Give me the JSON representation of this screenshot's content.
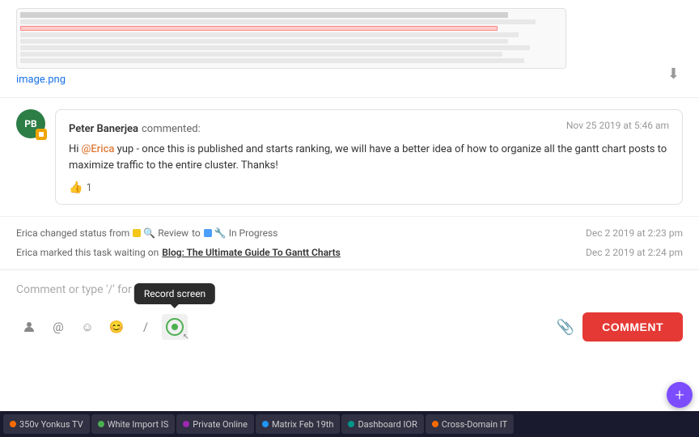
{
  "image": {
    "filename": "image.png",
    "download_label": "⬇",
    "alt": "spreadsheet screenshot"
  },
  "comment": {
    "author": "Peter Banerjea",
    "action": "commented:",
    "timestamp": "Nov 25 2019 at 5:46 am",
    "avatar_initials": "PB",
    "text_part1": "Hi ",
    "mention": "@Erica",
    "text_part2": " yup - once this is published and starts ranking, we will have a better idea of how to organize all the gantt chart posts to maximize traffic to the entire cluster. Thanks!",
    "likes": "1"
  },
  "activities": [
    {
      "text_prefix": "Erica changed status from",
      "from_status": "Review",
      "from_color": "#f5c518",
      "to_label": "to",
      "to_status": "In Progress",
      "to_color": "#4a9eff",
      "timestamp": "Dec 2 2019 at 2:23 pm"
    },
    {
      "text_prefix": "Erica marked this task waiting on",
      "link": "Blog: The Ultimate Guide To Gantt Charts",
      "timestamp": "Dec 2 2019 at 2:24 pm"
    }
  ],
  "comment_input": {
    "placeholder": "Comment or type '/' for commands"
  },
  "tooltip": {
    "label": "Record screen"
  },
  "toolbar": {
    "icons": [
      {
        "name": "person-icon",
        "symbol": "👤"
      },
      {
        "name": "mention-icon",
        "symbol": "@"
      },
      {
        "name": "emoji-icon",
        "symbol": "☺"
      },
      {
        "name": "smiley-icon",
        "symbol": "😊"
      },
      {
        "name": "slash-icon",
        "symbol": "/"
      },
      {
        "name": "record-screen-icon",
        "symbol": "record"
      },
      {
        "name": "attach-icon",
        "symbol": "📎"
      }
    ],
    "comment_button_label": "COMMENT"
  },
  "taskbar": {
    "items": [
      {
        "label": "350v Yonkus TV",
        "color_class": "dot-orange"
      },
      {
        "label": "White Import IS",
        "color_class": "dot-green"
      },
      {
        "label": "Private Online",
        "color_class": "dot-purple"
      },
      {
        "label": "Matrix Feb 19th",
        "color_class": "dot-blue"
      },
      {
        "label": "Dashboard IOR",
        "color_class": "dot-teal"
      },
      {
        "label": "Cross-Domain IT",
        "color_class": "dot-orange"
      }
    ]
  },
  "fab": {
    "label": "+"
  }
}
